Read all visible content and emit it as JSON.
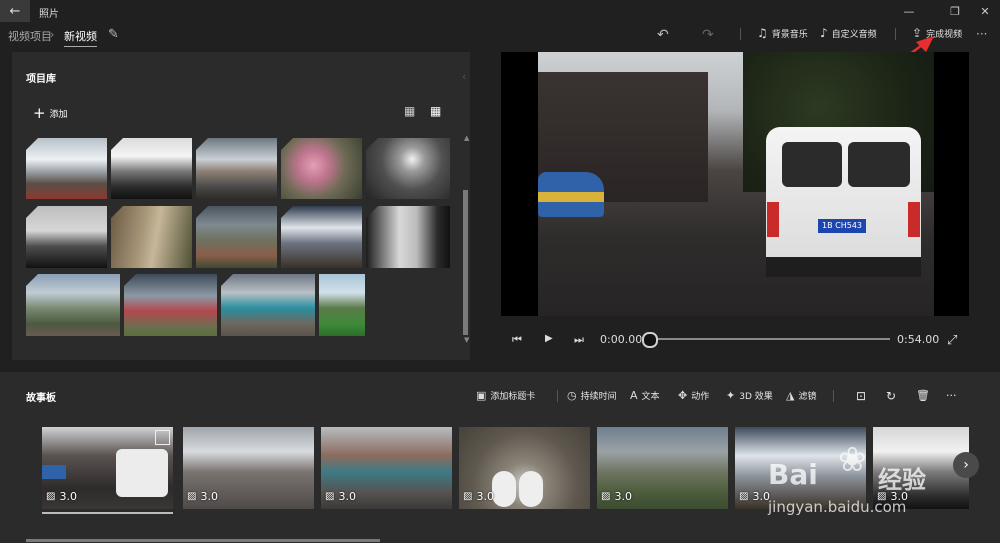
{
  "app": {
    "title": "照片"
  },
  "window": {
    "back": "←",
    "minimize": "—",
    "restore": "❐",
    "close": "✕"
  },
  "header": {
    "crumb_parent": "视频项目",
    "crumb_sep": "›",
    "crumb_current": "新视频",
    "edit_icon": "✎"
  },
  "toolbar": {
    "undo": "↶",
    "redo": "↷",
    "bg_music": "背景音乐",
    "custom_audio": "自定义音频",
    "finish": "完成视频",
    "more": "···"
  },
  "library": {
    "title": "项目库",
    "add_label": "添加",
    "add_icon": "+",
    "view_large": "▦",
    "view_small": "▦"
  },
  "player": {
    "current_time": "0:00.00",
    "total_time": "0:54.00",
    "progress": 0,
    "prev": "⏮",
    "play": "▶",
    "next": "⏭",
    "fullscreen": "⤢"
  },
  "storyboard": {
    "title": "故事板",
    "tools": [
      "添加标题卡",
      "持续时间",
      "文本",
      "动作",
      "3D 效果",
      "滤镜"
    ],
    "tool_icons": [
      "▣",
      "◷",
      "A",
      "✥",
      "✦",
      "◮"
    ],
    "extra_icons": [
      "⊡",
      "↻",
      "🗑",
      "···"
    ],
    "cards": [
      {
        "duration": "3.0"
      },
      {
        "duration": "3.0"
      },
      {
        "duration": "3.0"
      },
      {
        "duration": "3.0"
      },
      {
        "duration": "3.0"
      },
      {
        "duration": "3.0"
      },
      {
        "duration": "3.0"
      }
    ],
    "next": "›"
  },
  "plate_text": "1B CH543",
  "watermark": {
    "brand": "Bai",
    "brand2": "经验",
    "url": "jingyan.baidu.com"
  },
  "colors": {
    "bg": "#202020",
    "panel": "#2b2b2b",
    "accent": "#ffffff"
  }
}
